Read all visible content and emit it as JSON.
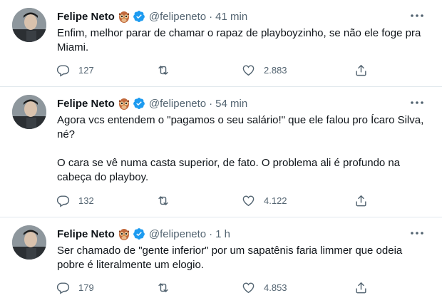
{
  "tweets": [
    {
      "author_name": "Felipe Neto",
      "author_handle": "@felipeneto",
      "separator": "·",
      "time": "41 min",
      "paragraphs": [
        "Enfim, melhor parar de chamar o rapaz de playboyzinho, se não ele foge pra Miami."
      ],
      "reply_count": "127",
      "retweet_count": "",
      "like_count": "2.883"
    },
    {
      "author_name": "Felipe Neto",
      "author_handle": "@felipeneto",
      "separator": "·",
      "time": "54 min",
      "paragraphs": [
        "Agora vcs entendem o \"pagamos o seu salário!\" que ele falou pro Ícaro Silva, né?",
        "O cara se vê numa casta superior, de fato. O problema ali é profundo na cabeça do playboy."
      ],
      "reply_count": "132",
      "retweet_count": "",
      "like_count": "4.122"
    },
    {
      "author_name": "Felipe Neto",
      "author_handle": "@felipeneto",
      "separator": "·",
      "time": "1 h",
      "paragraphs": [
        "Ser chamado de \"gente inferior\" por um sapatênis faria limmer que odeia pobre é literalmente um elogio."
      ],
      "reply_count": "179",
      "retweet_count": "",
      "like_count": "4.853"
    }
  ],
  "icons": {
    "reply": "reply-icon",
    "retweet": "retweet-icon",
    "like": "heart-icon",
    "share": "share-icon",
    "more": "more-options-icon",
    "verified": "verified-badge-icon",
    "emoji": "owl-emoji-icon"
  },
  "colors": {
    "text": "#0f1419",
    "secondary": "#536471",
    "verified": "#1d9bf0",
    "divider": "#e1e8ed"
  }
}
